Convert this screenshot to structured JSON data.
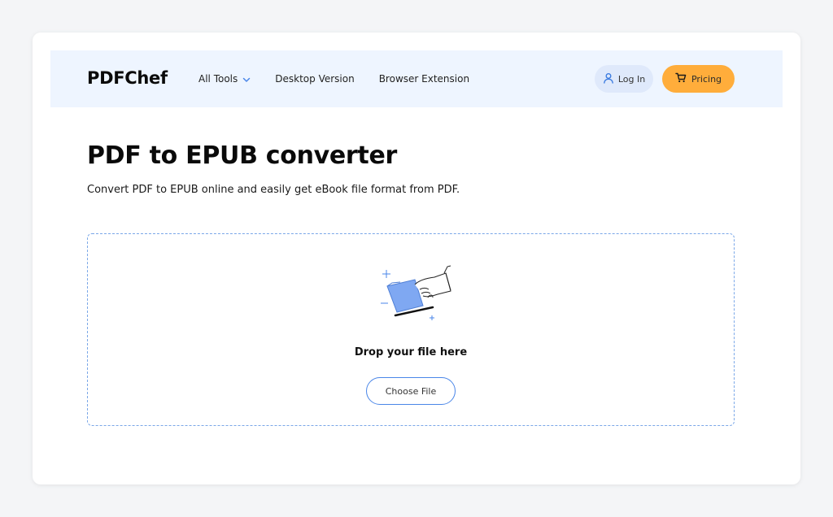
{
  "header": {
    "logo": "PDFChef",
    "nav": [
      {
        "label": "All Tools",
        "has_dropdown": true
      },
      {
        "label": "Desktop Version"
      },
      {
        "label": "Browser Extension"
      }
    ],
    "login_label": "Log In",
    "pricing_label": "Pricing",
    "icons": {
      "chevron": "chevron-down-icon",
      "user": "user-icon",
      "cart": "cart-icon"
    }
  },
  "main": {
    "title": "PDF to EPUB converter",
    "subtitle": "Convert PDF to EPUB online and easily get eBook file format from PDF.",
    "dropzone": {
      "text": "Drop your file here",
      "button_label": "Choose File"
    }
  },
  "colors": {
    "header_bg": "#eef5ff",
    "login_bg": "#dfe9fb",
    "pricing_bg": "#ffad3b",
    "accent_blue": "#4a86e8",
    "dropzone_border": "#7aa7e8",
    "page_bg": "#f4f5f7"
  }
}
